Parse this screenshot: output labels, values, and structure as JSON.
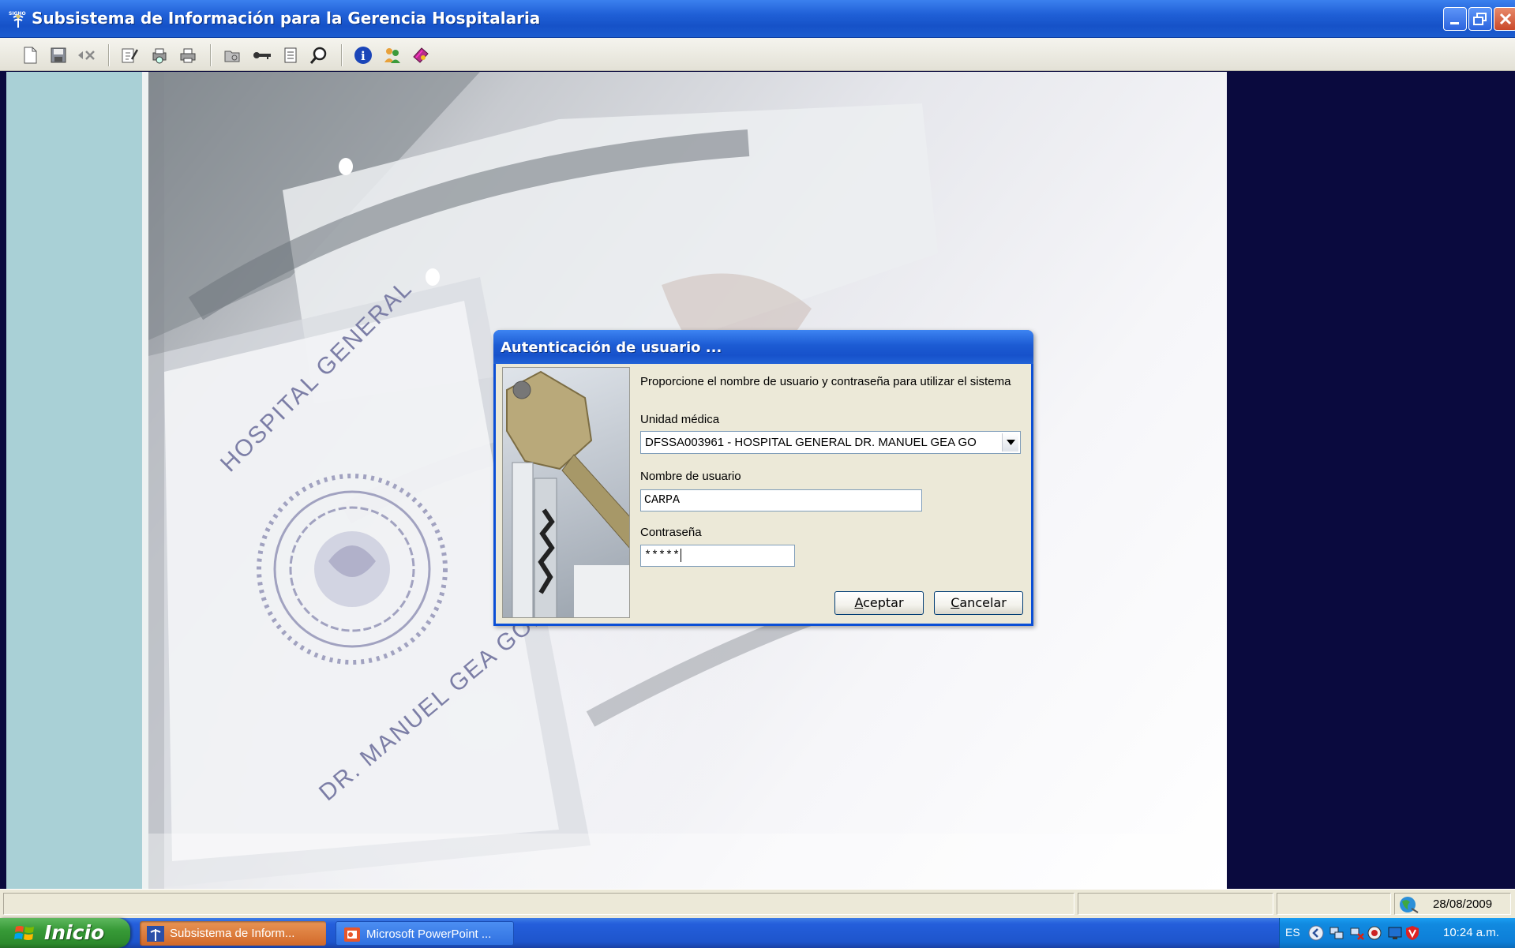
{
  "window": {
    "title": "Subsistema de Información para la Gerencia Hospitalaria",
    "logo_text": "SIGHO"
  },
  "toolbar": {
    "icons": [
      "new-icon",
      "save-icon",
      "delete-icon",
      "edit-icon",
      "print-preview-icon",
      "print-icon",
      "open-folder-icon",
      "key-icon",
      "document-icon",
      "search-icon",
      "info-icon",
      "users-icon",
      "book-icon"
    ]
  },
  "background": {
    "seal_text_top": "HOSPITAL GENERAL",
    "seal_text_bottom": "DR. MANUEL GEA GONZA"
  },
  "dialog": {
    "title": "Autenticación de usuario ...",
    "prompt": "Proporcione el nombre de usuario y contraseña para utilizar el sistema",
    "unidad_label": "Unidad médica",
    "unidad_value": "DFSSA003961 - HOSPITAL GENERAL DR. MANUEL GEA GO",
    "user_label": "Nombre de usuario",
    "user_value": "CARPA",
    "password_label": "Contraseña",
    "password_value": "*****",
    "ok_label": "ceptar",
    "ok_mnemonic": "A",
    "cancel_label": "ancelar",
    "cancel_mnemonic": "C"
  },
  "statusbar": {
    "date": "28/08/2009"
  },
  "taskbar": {
    "start_label": "Inicio",
    "tasks": [
      {
        "label": "Subsistema de Inform..."
      },
      {
        "label": "Microsoft PowerPoint ..."
      }
    ],
    "tray_lang": "ES",
    "clock": "10:24 a.m."
  },
  "colors": {
    "titlebar": "#1f5fd6",
    "left_pane": "#a9d0d6",
    "dark_pane": "#0a0a3e",
    "dialog_bg": "#ece9d8",
    "start_green": "#379a37"
  }
}
